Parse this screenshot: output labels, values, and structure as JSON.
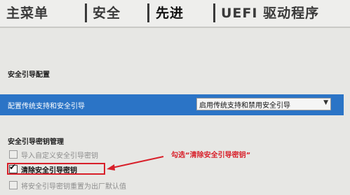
{
  "tabs": [
    "主菜单",
    "安全",
    "先进",
    "UEFI 驱动程序"
  ],
  "active_tab": "先进",
  "sections": {
    "secure_boot_config": "安全引导配置",
    "key_management": "安全引导密钥管理"
  },
  "setting_row": {
    "label": "配置传统支持和安全引导",
    "value": "启用传统支持和禁用安全引导"
  },
  "key_items": [
    {
      "label": "导入自定义安全引导密钥",
      "checked": false
    },
    {
      "label": "清除安全引导密钥",
      "checked": true
    },
    {
      "label": "将安全引导密钥重置为出厂默认值",
      "checked": false
    }
  ],
  "annotation": "勾选“清除安全引导密钥”",
  "colors": {
    "highlight_bar": "#2b74c6",
    "annotation": "#d8202a"
  }
}
